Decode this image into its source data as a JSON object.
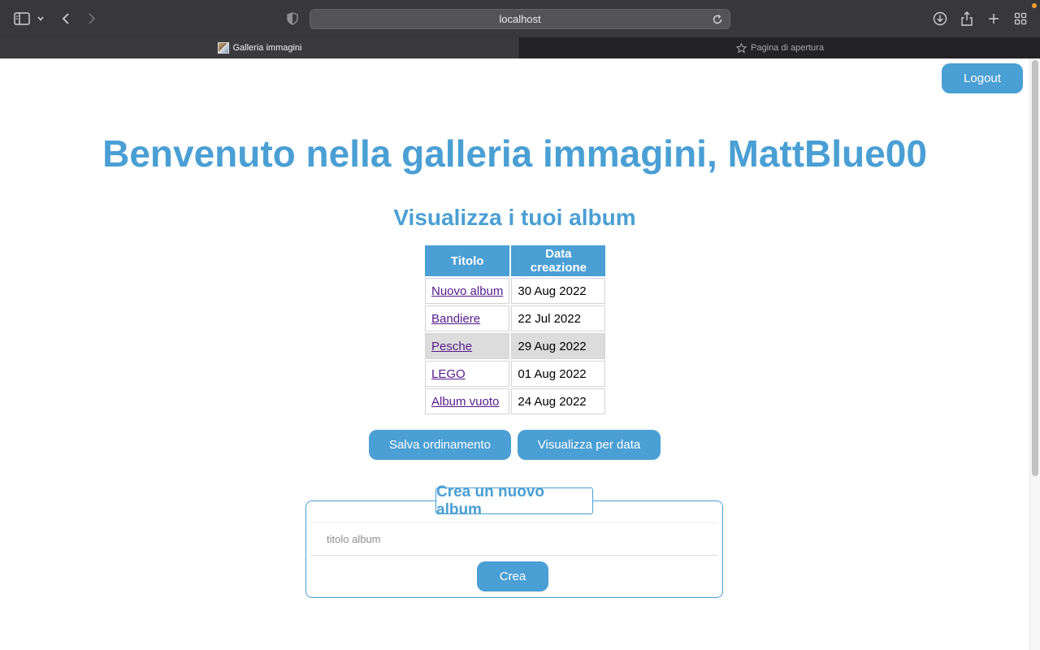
{
  "browser": {
    "url": "localhost",
    "tabs": [
      {
        "label": "Galleria immagini",
        "active": true
      },
      {
        "label": "Pagina di apertura",
        "active": false
      }
    ]
  },
  "page": {
    "logout_label": "Logout",
    "welcome_title": "Benvenuto nella galleria immagini, MattBlue00",
    "albums_heading": "Visualizza i tuoi album",
    "table": {
      "headers": [
        "Titolo",
        "Data creazione"
      ],
      "rows": [
        {
          "title": "Nuovo album",
          "date": "30 Aug 2022"
        },
        {
          "title": "Bandiere",
          "date": "22 Jul 2022"
        },
        {
          "title": "Pesche",
          "date": "29 Aug 2022"
        },
        {
          "title": "LEGO",
          "date": "01 Aug 2022"
        },
        {
          "title": "Album vuoto",
          "date": "24 Aug 2022"
        }
      ]
    },
    "save_order_label": "Salva ordinamento",
    "view_by_date_label": "Visualizza per data",
    "create_form": {
      "legend": "Crea un nuovo album",
      "input_placeholder": "titolo album",
      "input_value": "",
      "submit_label": "Crea"
    }
  },
  "colors": {
    "accent": "#4a9fd4",
    "visited_link": "#551a8b",
    "highlight_row": "#dcdcdc"
  }
}
